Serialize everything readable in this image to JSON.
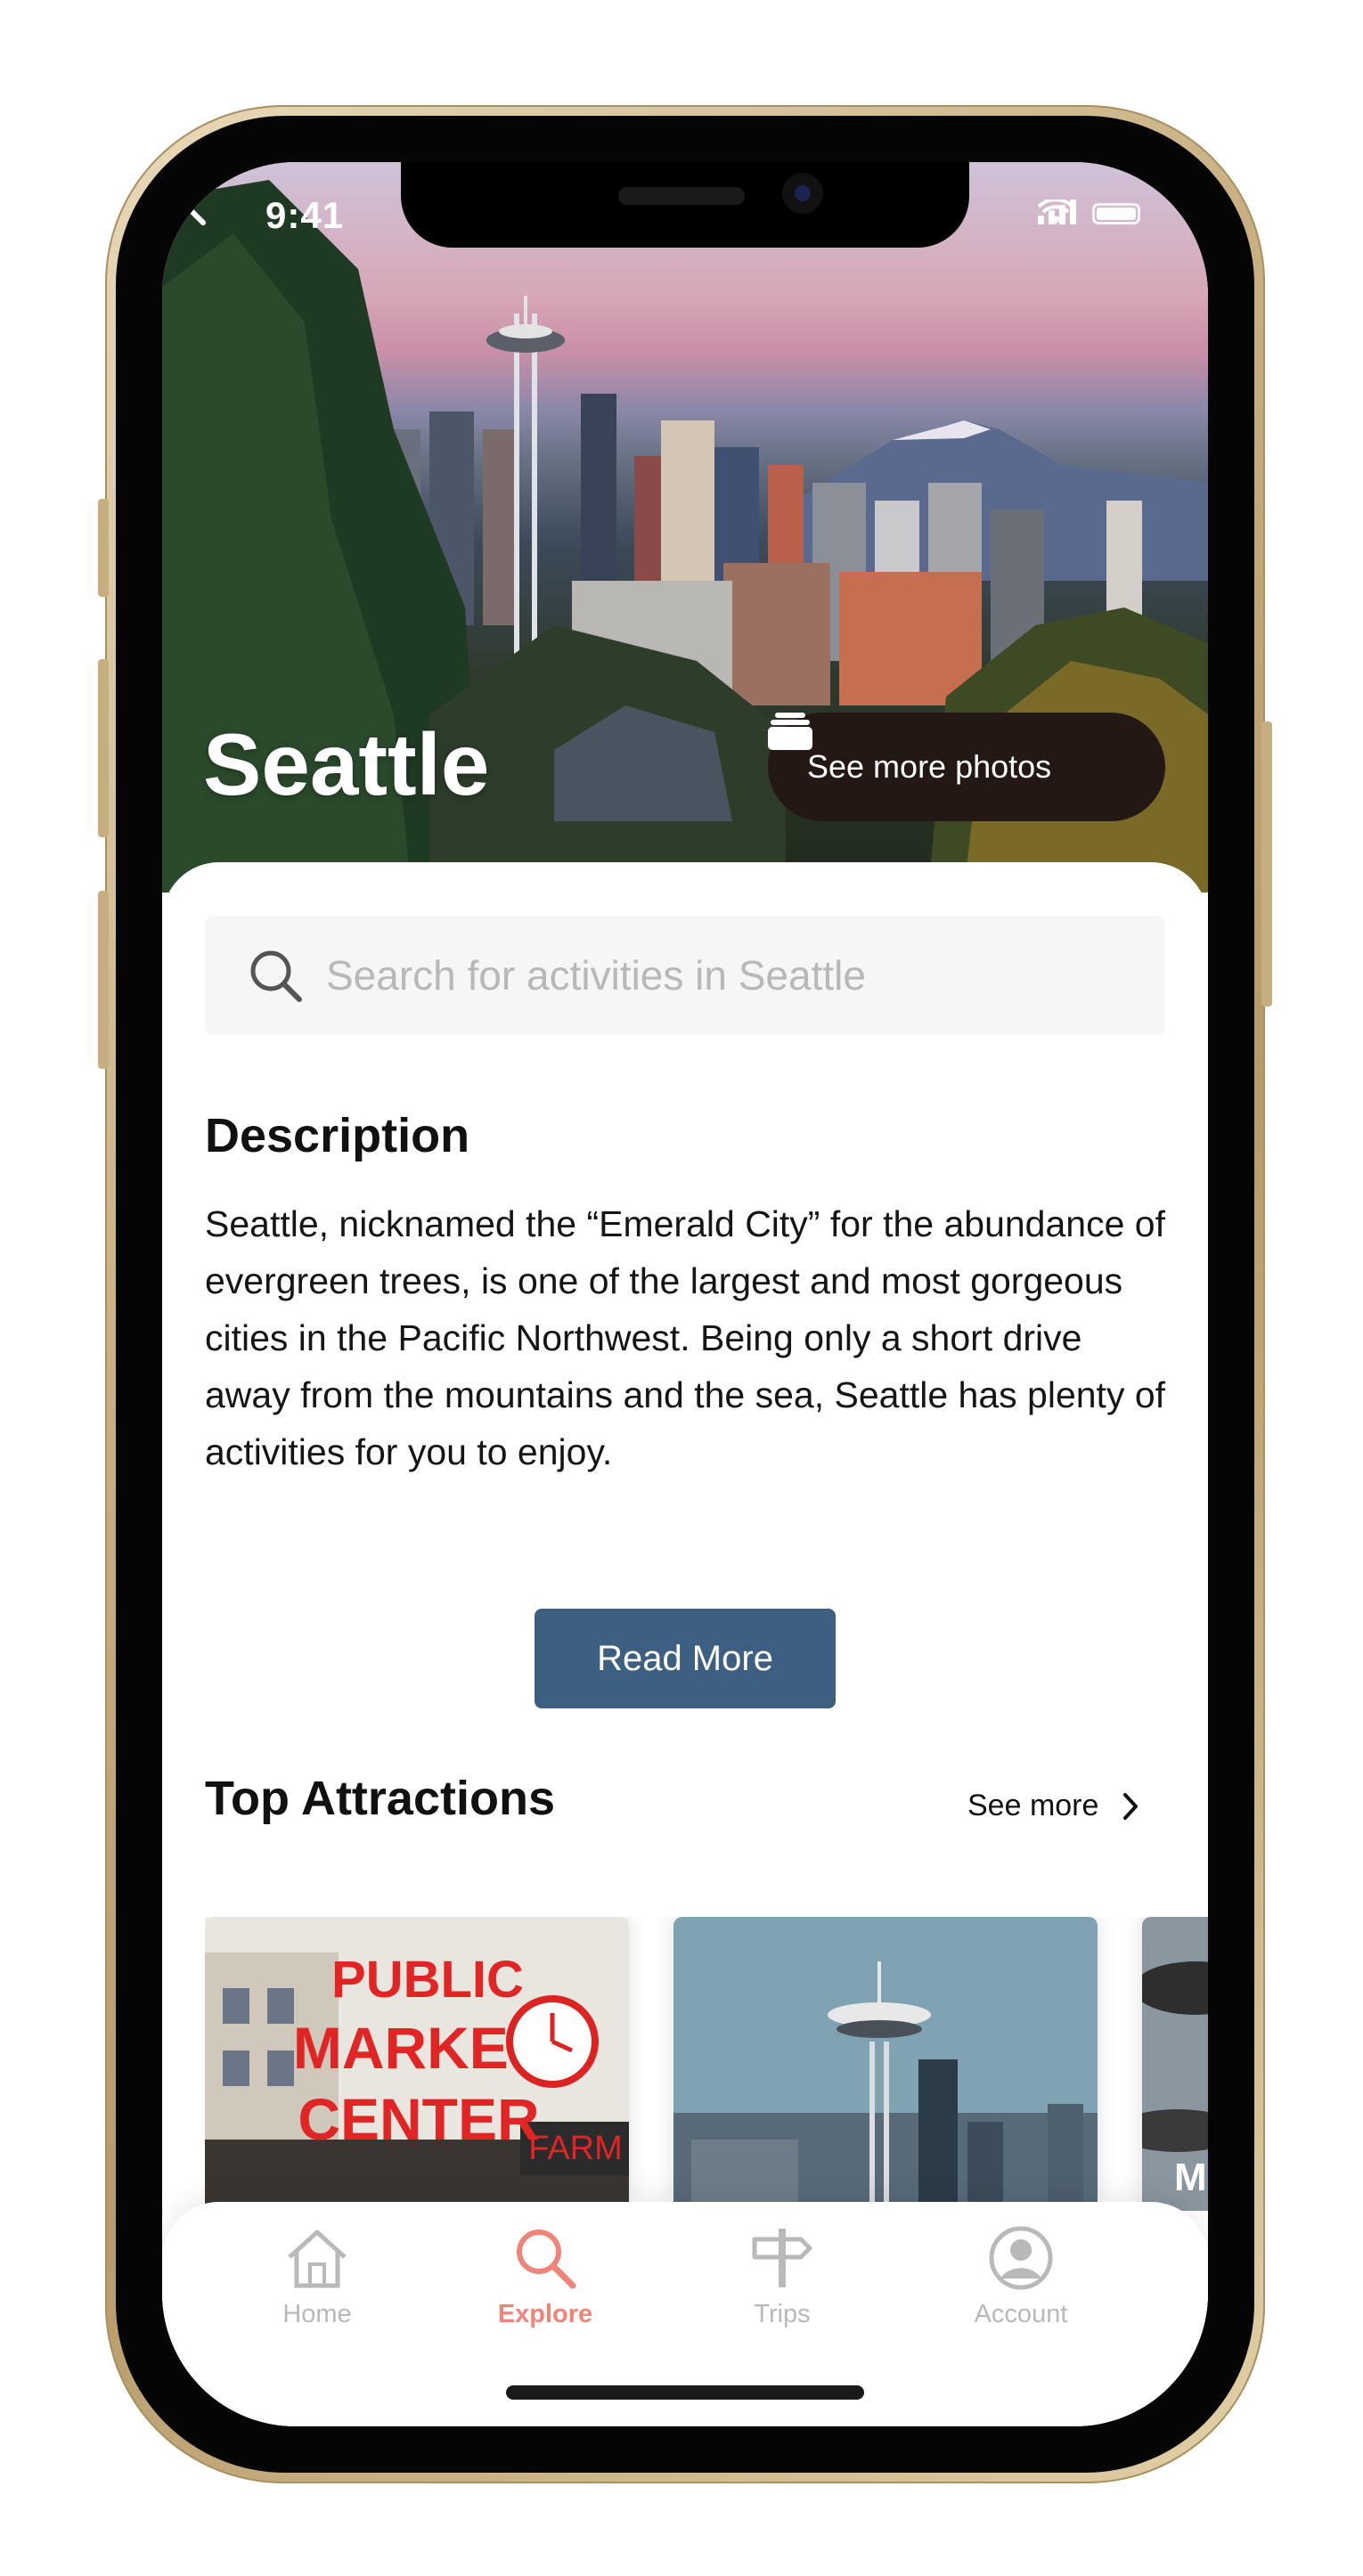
{
  "status_bar": {
    "time": "9:41"
  },
  "hero": {
    "city": "Seattle",
    "photos_button": "See more photos"
  },
  "search": {
    "placeholder": "Search for activities in Seattle"
  },
  "description": {
    "heading": "Description",
    "text": "Seattle, nicknamed the “Emerald City” for the abundance of evergreen trees, is one of the largest and most gorgeous cities in the Pacific Northwest. Being only a short drive away from the mountains and the sea, Seattle has plenty of activities for you to enjoy.",
    "read_more": "Read More"
  },
  "attractions": {
    "heading": "Top Attractions",
    "see_more": "See more",
    "cards": [
      {
        "image": "Pike Place Market sign",
        "sign_text": "PUBLIC MARKET CENTER",
        "side_sign": "FARM"
      },
      {
        "image": "Space Needle"
      },
      {
        "image": "museum aircraft",
        "label": "M"
      }
    ]
  },
  "tabbar": {
    "tabs": [
      {
        "label": "Home",
        "icon": "home-icon"
      },
      {
        "label": "Explore",
        "icon": "search-icon",
        "active": true
      },
      {
        "label": "Trips",
        "icon": "signpost-icon"
      },
      {
        "label": "Account",
        "icon": "account-icon"
      }
    ]
  },
  "colors": {
    "accent": "#ef8478",
    "button": "#3d5f82",
    "photos_button": "#241814"
  }
}
